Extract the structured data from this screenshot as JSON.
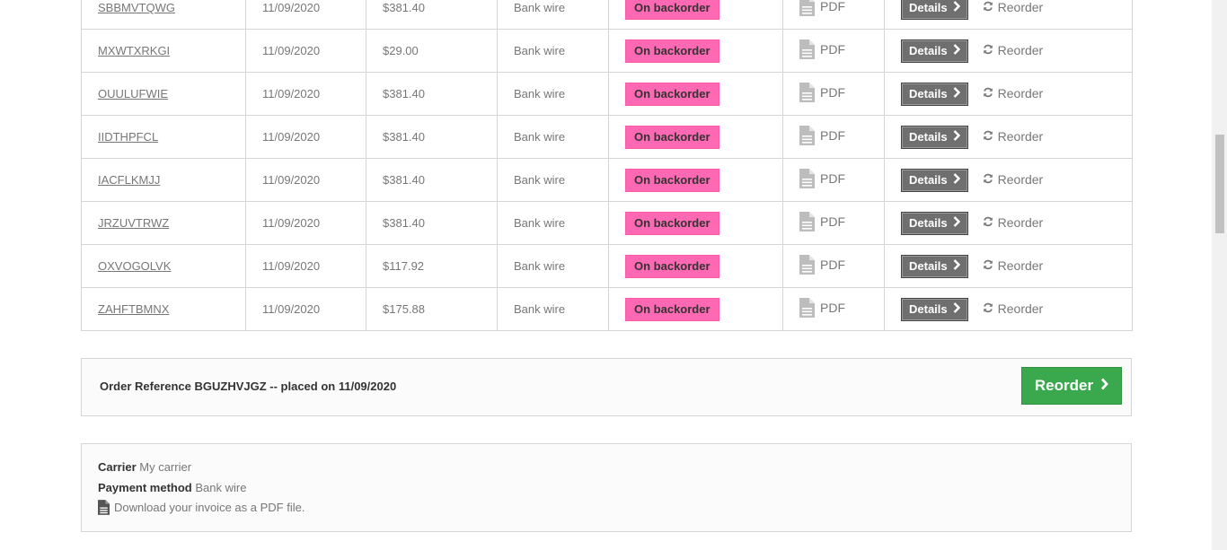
{
  "orders": [
    {
      "ref": "SBBMVTQWG",
      "date": "11/09/2020",
      "price": "$381.40",
      "payment": "Bank wire",
      "status": "On backorder",
      "invoice": "PDF",
      "details": "Details",
      "reorder": "Reorder"
    },
    {
      "ref": "MXWTXRKGI",
      "date": "11/09/2020",
      "price": "$29.00",
      "payment": "Bank wire",
      "status": "On backorder",
      "invoice": "PDF",
      "details": "Details",
      "reorder": "Reorder"
    },
    {
      "ref": "OUULUFWIE",
      "date": "11/09/2020",
      "price": "$381.40",
      "payment": "Bank wire",
      "status": "On backorder",
      "invoice": "PDF",
      "details": "Details",
      "reorder": "Reorder"
    },
    {
      "ref": "IIDTHPFCL",
      "date": "11/09/2020",
      "price": "$381.40",
      "payment": "Bank wire",
      "status": "On backorder",
      "invoice": "PDF",
      "details": "Details",
      "reorder": "Reorder"
    },
    {
      "ref": "IACFLKMJJ",
      "date": "11/09/2020",
      "price": "$381.40",
      "payment": "Bank wire",
      "status": "On backorder",
      "invoice": "PDF",
      "details": "Details",
      "reorder": "Reorder"
    },
    {
      "ref": "JRZUVTRWZ",
      "date": "11/09/2020",
      "price": "$381.40",
      "payment": "Bank wire",
      "status": "On backorder",
      "invoice": "PDF",
      "details": "Details",
      "reorder": "Reorder"
    },
    {
      "ref": "OXVOGOLVK",
      "date": "11/09/2020",
      "price": "$117.92",
      "payment": "Bank wire",
      "status": "On backorder",
      "invoice": "PDF",
      "details": "Details",
      "reorder": "Reorder"
    },
    {
      "ref": "ZAHFTBMNX",
      "date": "11/09/2020",
      "price": "$175.88",
      "payment": "Bank wire",
      "status": "On backorder",
      "invoice": "PDF",
      "details": "Details",
      "reorder": "Reorder"
    }
  ],
  "order_ref_box": {
    "text": "Order Reference BGUZHVJGZ -- placed on 11/09/2020",
    "reorder_label": "Reorder"
  },
  "info": {
    "carrier_label": "Carrier",
    "carrier_value": "My carrier",
    "payment_label": "Payment method",
    "payment_value": "Bank wire",
    "download_text": "Download your invoice as a PDF file."
  },
  "colors": {
    "status_bg": "#ff69b4",
    "reorder_button": "#3aa84c",
    "details_button": "#6f6f6f"
  },
  "icons": {
    "invoice": "file-icon",
    "reorder": "refresh-icon",
    "details": "chevron-right-icon"
  }
}
